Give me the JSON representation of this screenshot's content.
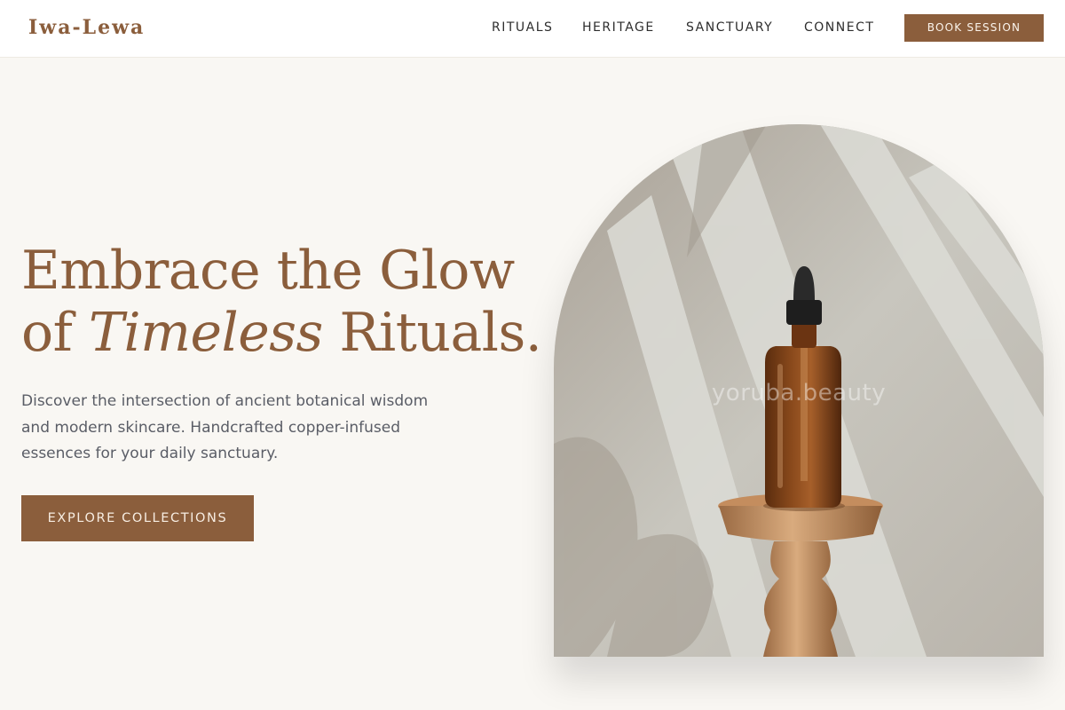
{
  "brand": {
    "name": "Iwa-Lewa"
  },
  "nav": {
    "links": [
      {
        "label": "RITUALS"
      },
      {
        "label": "HERITAGE"
      },
      {
        "label": "SANCTUARY"
      },
      {
        "label": "CONNECT"
      }
    ],
    "cta_label": "BOOK SESSION"
  },
  "hero": {
    "title_line1": "Embrace the Glow",
    "title_line2_pre": "of ",
    "title_line2_em": "Timeless",
    "title_line2_post": " Rituals.",
    "description": "Discover the intersection of ancient botanical wisdom and modern skincare. Handcrafted copper-infused essences for your daily sanctuary.",
    "cta_label": "EXPLORE COLLECTIONS"
  },
  "image": {
    "watermark": "yoruba.beauty"
  },
  "colors": {
    "accent": "#8b5e3c",
    "background": "#f9f7f3",
    "header": "#ffffff",
    "body_text": "#5a5d66"
  }
}
